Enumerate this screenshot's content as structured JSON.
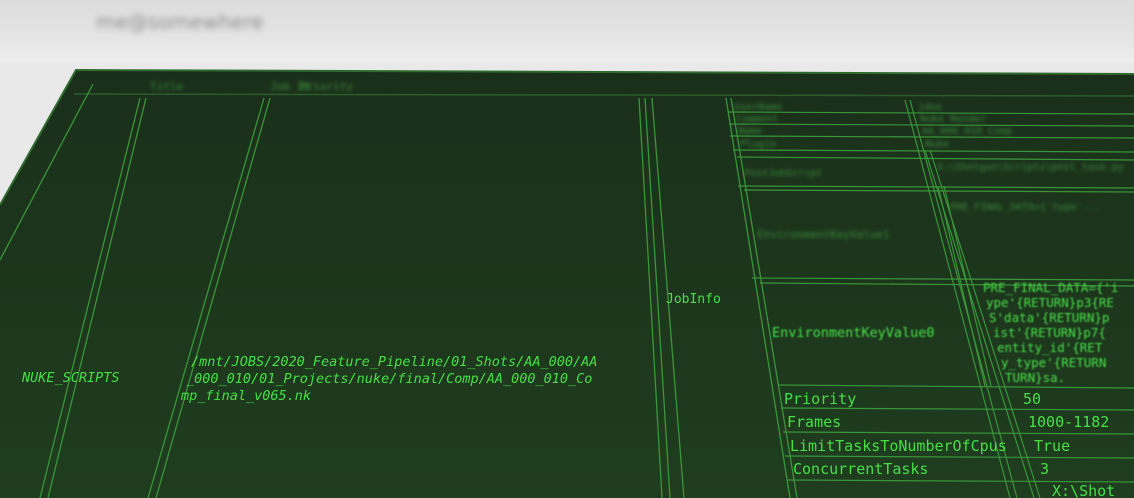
{
  "header": {
    "user_label": "me@somewhere"
  },
  "table": {
    "header_blurred": [
      "Title",
      "Job Id",
      "Priority"
    ],
    "row_type": "NUKE_SCRIPTS",
    "script_path_lines": [
      "/mnt/JOBS/2020_Feature_Pipeline/01_Shots/AA_000/AA",
      "_000_010/01_Projects/nuke/final/Comp/AA_000_010_Co",
      "mp_final_v065.nk"
    ],
    "group_label": "JobInfo"
  },
  "job_info": {
    "blurred_keys": [
      "UserName",
      "Comment",
      "Name",
      "Plugin",
      "PostJobScript",
      "EnvironmentKeyValue1"
    ],
    "blurred_values": [
      "jdoe",
      "Nuke Render",
      "AA_000_010_Comp",
      "Nuke",
      "X:\\Shotgun\\Scripts\\post_task.py",
      "PRE_FINAL_DATA={'type'..."
    ],
    "env_key0": "EnvironmentKeyValue0",
    "env_value0_lines": [
      "PRE_FINAL_DATA={'i",
      "ype'{RETURN}p3{RE",
      "S'data'{RETURN}p",
      "ist'{RETURN}p7{",
      "entity_id'{RET",
      "y_type'{RETURN",
      "TURN}sa."
    ],
    "rows": [
      {
        "key": "Priority",
        "value": "50"
      },
      {
        "key": "Frames",
        "value": "1000-1182"
      },
      {
        "key": "LimitTasksToNumberOfCpus",
        "value": "True"
      },
      {
        "key": "ConcurrentTasks",
        "value": "3"
      },
      {
        "key": "",
        "value": "X:\\Shot"
      }
    ]
  },
  "colors": {
    "background": "#1e3a1e",
    "grid_line": "#3ea03e",
    "text": "#46e046",
    "page": "#e9e9e9"
  }
}
